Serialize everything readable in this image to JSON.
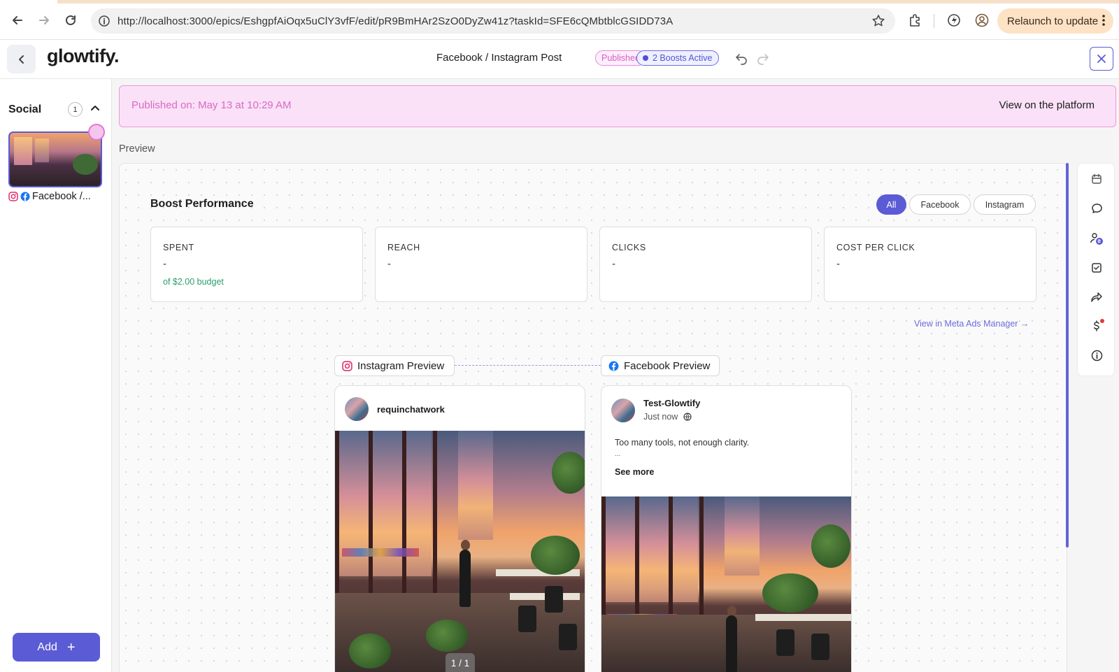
{
  "browser": {
    "url": "http://localhost:3000/epics/EshgpfAiOqx5uClY3vfF/edit/pR9BmHAr2SzO0DyZw41z?taskId=SFE6cQMbtblcGSIDD73A",
    "relaunch_label": "Relaunch to update",
    "icons": [
      "back-arrow-icon",
      "forward-arrow-icon",
      "reload-icon",
      "site-info-icon",
      "bookmark-star-icon",
      "extensions-icon",
      "extension-icon",
      "profile-icon",
      "more-vertical-icon"
    ]
  },
  "header": {
    "logo": "glowtify.",
    "title": "Facebook / Instagram Post",
    "status_badge": "Published",
    "boosts_badge": "2 Boosts Active"
  },
  "sidebar": {
    "section_title": "Social",
    "count": "1",
    "item_label": "Facebook /...",
    "add_label": "Add",
    "add_icon": "+"
  },
  "banner": {
    "published_text": "Published on: May 13 at 10:29 AM",
    "link_label": "View on the platform"
  },
  "preview_label": "Preview",
  "boost": {
    "title": "Boost Performance",
    "filters": [
      "All",
      "Facebook",
      "Instagram"
    ],
    "active_filter": "All",
    "metrics": [
      {
        "label": "SPENT",
        "value": "-",
        "sub": "of $2.00 budget"
      },
      {
        "label": "REACH",
        "value": "-",
        "sub": ""
      },
      {
        "label": "CLICKS",
        "value": "-",
        "sub": ""
      },
      {
        "label": "COST PER CLICK",
        "value": "-",
        "sub": ""
      }
    ],
    "meta_link": "View in Meta Ads Manager →"
  },
  "previews": {
    "instagram": {
      "tag": "Instagram Preview",
      "username": "requinchatwork",
      "counter": "1 / 1"
    },
    "facebook": {
      "tag": "Facebook Preview",
      "page_name": "Test-Glowtify",
      "time": "Just now",
      "body": "Too many tools, not enough clarity.",
      "ellipsis": "...",
      "see_more": "See more"
    }
  },
  "right_toolbar": {
    "icons": [
      "calendar-icon",
      "comment-icon",
      "assign-user-icon",
      "task-checkbox-icon",
      "share-icon",
      "dollar-icon",
      "info-icon"
    ]
  },
  "colors": {
    "accent": "#5b5bd6",
    "published_pink": "#d66ac6",
    "banner_bg": "#fbe1f7",
    "budget_green": "#2a9d6c"
  }
}
